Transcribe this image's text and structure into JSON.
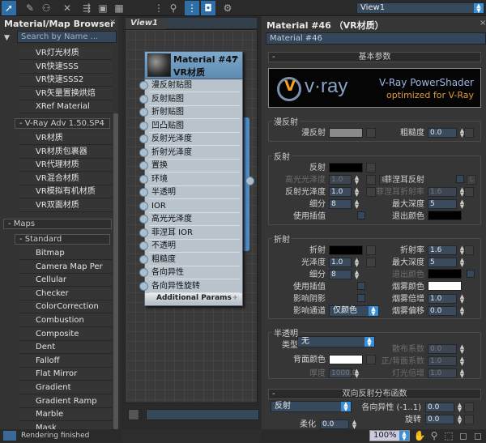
{
  "toolbar": {
    "view_select": "View1",
    "icons": [
      "select-icon",
      "eyedropper-icon",
      "assign-icon",
      "delete-icon",
      "move-children-icon",
      "material-icon",
      "pattern-icon",
      "layout-icon",
      "layout-children-icon",
      "show-map-icon",
      "show-end-result-icon",
      "bg-icon"
    ]
  },
  "browser": {
    "title": "Material/Map Browser",
    "close": "×",
    "search_placeholder": "Search by Name ...",
    "items_top": [
      {
        "label": "VR灯光材质",
        "color": "#ffffff"
      },
      {
        "label": "VR快速SSS",
        "color": "#c07a3a"
      },
      {
        "label": "VR快速SSS2",
        "color": "#555555"
      },
      {
        "label": "VR矢量置换烘焙",
        "color": "#888888"
      },
      {
        "label": "XRef Material",
        "color": "#111111"
      }
    ],
    "group_vray": "- V-Ray Adv 1.50.SP4",
    "items_vray": [
      {
        "label": "VR材质",
        "color": "#666666"
      },
      {
        "label": "VR材质包裹器",
        "color": "#000000"
      },
      {
        "label": "VR代理材质",
        "color": "#000000"
      },
      {
        "label": "VR混合材质",
        "color": ""
      },
      {
        "label": "VR模拟有机材质",
        "color": "#dd0000"
      },
      {
        "label": "VR双面材质",
        "color": ""
      }
    ],
    "group_maps": "- Maps",
    "group_standard": "- Standard",
    "maps": [
      "Bitmap",
      "Camera Map Per Pixel",
      "Cellular",
      "Checker",
      "ColorCorrection",
      "Combustion",
      "Composite",
      "Dent",
      "Falloff",
      "Flat Mirror",
      "Gradient",
      "Gradient Ramp",
      "Marble",
      "Mask"
    ],
    "status": "Rendering finished"
  },
  "view": {
    "tab": "View1",
    "node": {
      "title": "Material #47",
      "subtitle": "VR材质",
      "collapse": "−",
      "slots": [
        "漫反射贴图",
        "反射贴图",
        "折射贴图",
        "凹凸贴图",
        "反射光泽度",
        "折射光泽度",
        "置换",
        "环境",
        "半透明",
        "IOR",
        "高光光泽度",
        "菲涅耳 IOR",
        "不透明",
        "粗糙度",
        "各向异性",
        "各向异性旋转"
      ],
      "additional": "Additional Params",
      "additional_toggle": "+"
    }
  },
  "editor": {
    "title": "Material #46 （VR材质）",
    "close": "×",
    "name": "Material #46",
    "rollout_basic": "基本参数",
    "rollout_minus": "-",
    "logo": {
      "brand": "v·ray",
      "line1": "V-Ray PowerShader",
      "line2": "optimized for V-Ray"
    },
    "diffuse": {
      "group": "漫反射",
      "diffuse": "漫反射",
      "diffuse_color": "#8a8a8a",
      "roughness": "粗糙度",
      "roughness_val": "0.0"
    },
    "reflect": {
      "group": "反射",
      "reflect": "反射",
      "reflect_color": "#000000",
      "hilight": "高光光泽度",
      "hilight_val": "1.0",
      "lock": "L",
      "refl_gloss": "反射光泽度",
      "refl_gloss_val": "1.0",
      "subdivs": "细分",
      "subdivs_val": "8",
      "interp": "使用插值",
      "fresnel": "菲涅耳反射",
      "fresnel_ior": "菲涅耳折射率",
      "fresnel_ior_val": "1.6",
      "max_depth": "最大深度",
      "max_depth_val": "5",
      "exit": "退出颜色",
      "exit_color": "#000000"
    },
    "refract": {
      "group": "折射",
      "refract": "折射",
      "refract_color": "#000000",
      "gloss": "光泽度",
      "gloss_val": "1.0",
      "subdivs": "细分",
      "subdivs_val": "8",
      "interp": "使用插值",
      "shadows": "影响阴影",
      "channels": "影响通道",
      "channels_val": "仅颜色",
      "ior": "折射率",
      "ior_val": "1.6",
      "max_depth": "最大深度",
      "max_depth_val": "5",
      "exit": "退出颜色",
      "exit_color": "#000000",
      "fog_color": "烟雾颜色",
      "fog_color_val": "#ffffff",
      "fog_mult": "烟雾倍增",
      "fog_mult_val": "1.0",
      "fog_bias": "烟雾偏移",
      "fog_bias_val": "0.0"
    },
    "translucency": {
      "group": "半透明",
      "type": "类型",
      "type_val": "无",
      "back": "背面颜色",
      "back_color": "#ffffff",
      "thickness": "厚度",
      "thickness_val": "1000.0",
      "scatter": "散布系数",
      "scatter_val": "0.0",
      "fwd_bck": "正/背面系数",
      "fwd_bck_val": "1.0",
      "light_mult": "灯光倍增",
      "light_mult_val": "1.0"
    },
    "brdf": {
      "rollout": "双向反射分布函数",
      "type_val": "反射",
      "aniso": "各向异性 (-1..1)",
      "aniso_val": "0.0",
      "rotation": "旋转",
      "rotation_val": "0.0",
      "soften": "柔化",
      "soften_val": "0.0"
    },
    "zoom": "100%"
  }
}
